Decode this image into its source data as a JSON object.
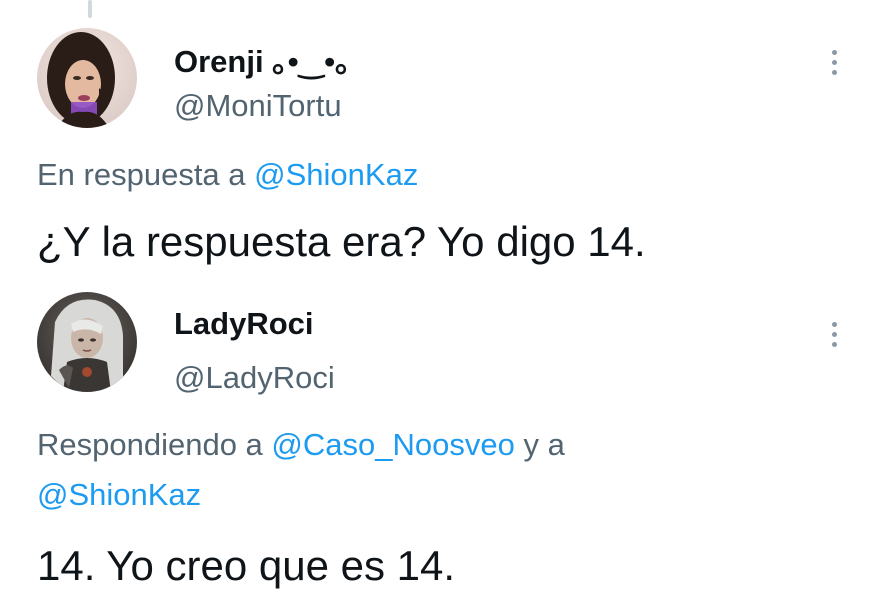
{
  "tweets": [
    {
      "display_name": "Orenji ｡•‿•｡",
      "handle": "@MoniTortu",
      "reply_prefix": "En respuesta a",
      "reply_mentions": [
        "@ShionKaz"
      ],
      "text": "¿Y la respuesta era? Yo digo 14."
    },
    {
      "display_name": "LadyRoci",
      "handle": "@LadyRoci",
      "reply_prefix": "Respondiendo a",
      "reply_mentions": [
        "@Caso_Noosveo",
        "@ShionKaz"
      ],
      "reply_joiner": "y a",
      "text": "14. Yo creo que es 14."
    }
  ],
  "icons": {
    "more": "more-vertical-icon"
  },
  "colors": {
    "text_primary": "#0f1419",
    "text_secondary": "#536471",
    "accent": "#1d9bf0",
    "background": "#ffffff"
  }
}
